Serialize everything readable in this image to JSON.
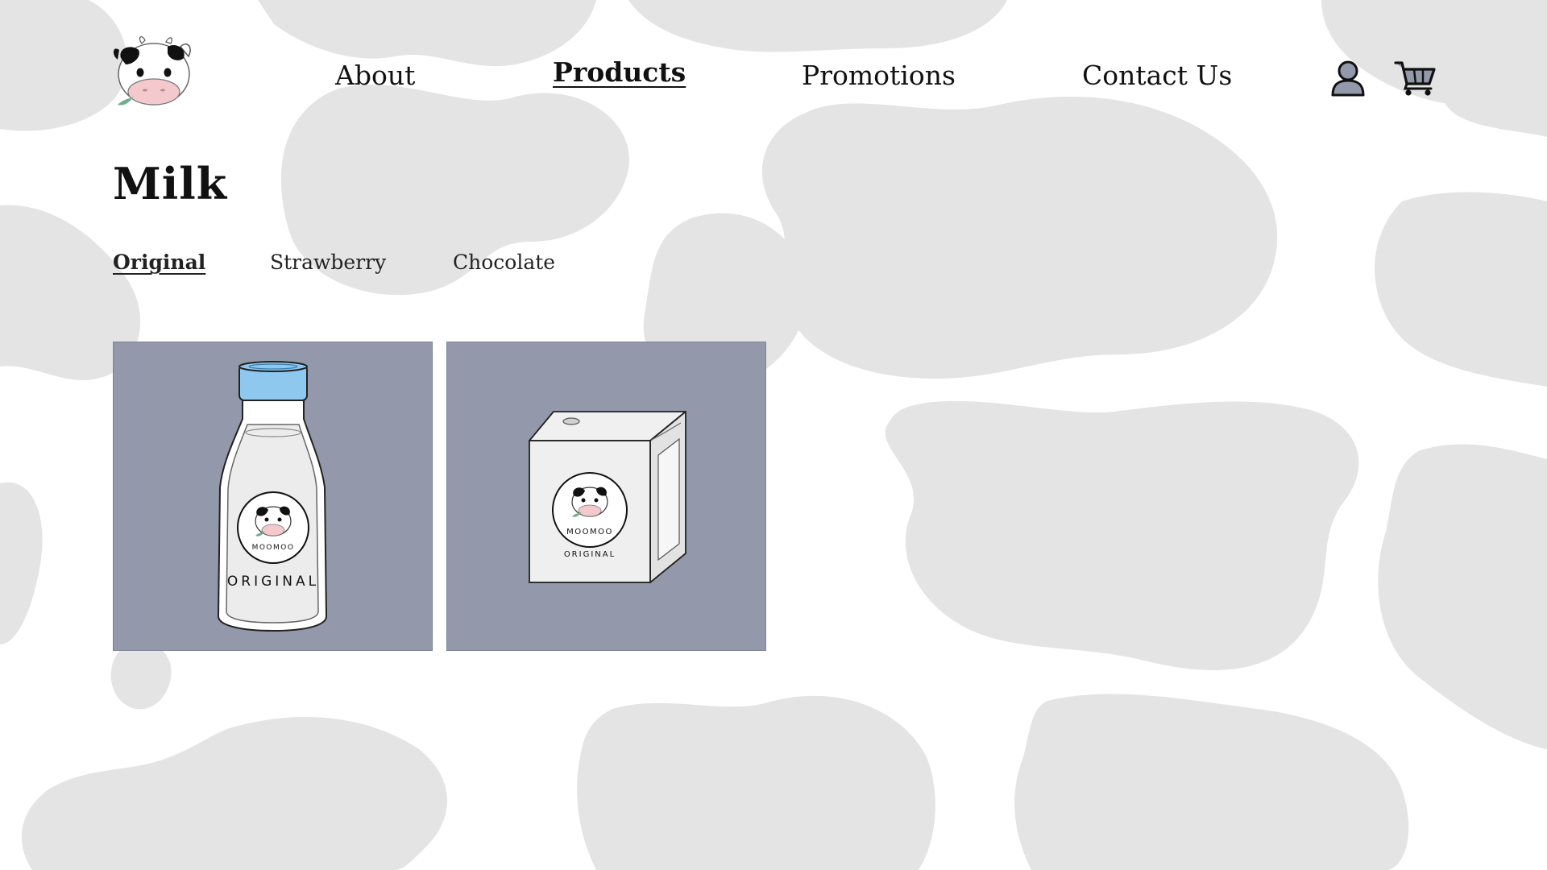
{
  "header": {
    "nav": {
      "about": "About",
      "products": "Products",
      "promotions": "Promotions",
      "contact": "Contact Us"
    },
    "icons": [
      "cow-logo",
      "user-icon",
      "cart-icon"
    ]
  },
  "page": {
    "title": "Milk",
    "tabs": {
      "original": "Original",
      "strawberry": "Strawberry",
      "chocolate": "Chocolate"
    },
    "selected_tab": "Original"
  },
  "products": [
    {
      "kind": "bottle",
      "brand": "MOOMOO",
      "flavor": "ORIGINAL"
    },
    {
      "kind": "carton",
      "brand": "MOOMOO",
      "flavor": "ORIGINAL"
    }
  ],
  "colors": {
    "card_background": "#9399aa",
    "cow_pattern": "#e4e4e4",
    "bottle_cap": "#8ec8ef",
    "cow_nose": "#f4c9cd",
    "leaf": "#6fae8e",
    "icon_fill": "#9399aa"
  }
}
